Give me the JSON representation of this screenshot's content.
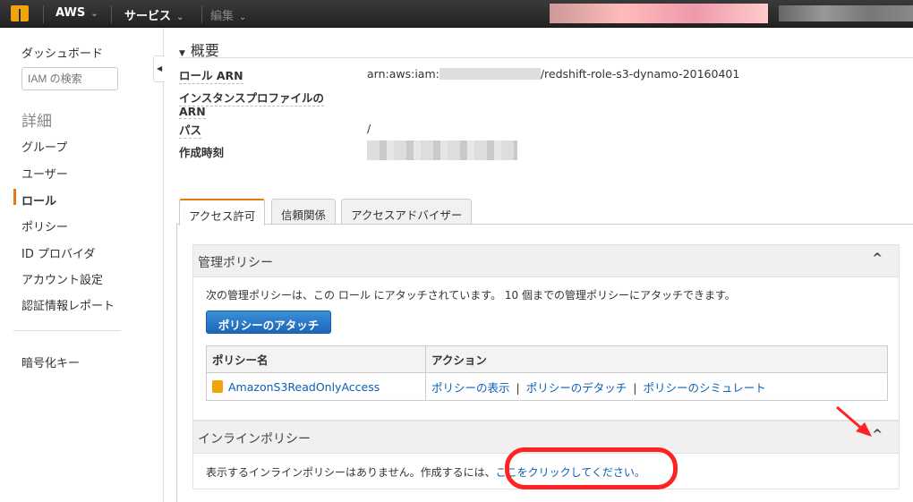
{
  "topbar": {
    "brand": "AWS",
    "services": "サービス",
    "edit": "編集"
  },
  "sidebar": {
    "dashboard": "ダッシュボード",
    "search_placeholder": "IAM の検索",
    "heading": "詳細",
    "items": [
      {
        "label": "グループ"
      },
      {
        "label": "ユーザー"
      },
      {
        "label": "ロール",
        "active": true
      },
      {
        "label": "ポリシー"
      },
      {
        "label": "ID プロバイダ"
      },
      {
        "label": "アカウント設定"
      },
      {
        "label": "認証情報レポート"
      }
    ],
    "encryption_keys": "暗号化キー"
  },
  "summary": {
    "title": "概要",
    "role_arn_label": "ロール ARN",
    "role_arn_prefix": "arn:aws:iam:",
    "role_arn_suffix": "/redshift-role-s3-dynamo-20160401",
    "instance_profile_label_1": "インスタンスプロファイルの",
    "instance_profile_label_2": "ARN",
    "path_label": "パス",
    "path_value": "/",
    "created_label": "作成時刻"
  },
  "tabs": [
    {
      "label": "アクセス許可",
      "active": true
    },
    {
      "label": "信頼関係"
    },
    {
      "label": "アクセスアドバイザー"
    }
  ],
  "managed": {
    "title": "管理ポリシー",
    "description": "次の管理ポリシーは、この ロール にアタッチされています。 10 個までの管理ポリシーにアタッチできます。",
    "attach_button": "ポリシーのアタッチ",
    "columns": [
      "ポリシー名",
      "アクション"
    ],
    "rows": [
      {
        "name": "AmazonS3ReadOnlyAccess",
        "actions": [
          "ポリシーの表示",
          "ポリシーのデタッチ",
          "ポリシーのシミュレート"
        ]
      }
    ]
  },
  "inline": {
    "title": "インラインポリシー",
    "message": "表示するインラインポリシーはありません。作成するには、",
    "link": "ここをクリックしてください。"
  },
  "colors": {
    "accent": "#e47911",
    "link": "#0a5fb4",
    "button": "#1b66b8",
    "annotation": "#ff2222"
  }
}
